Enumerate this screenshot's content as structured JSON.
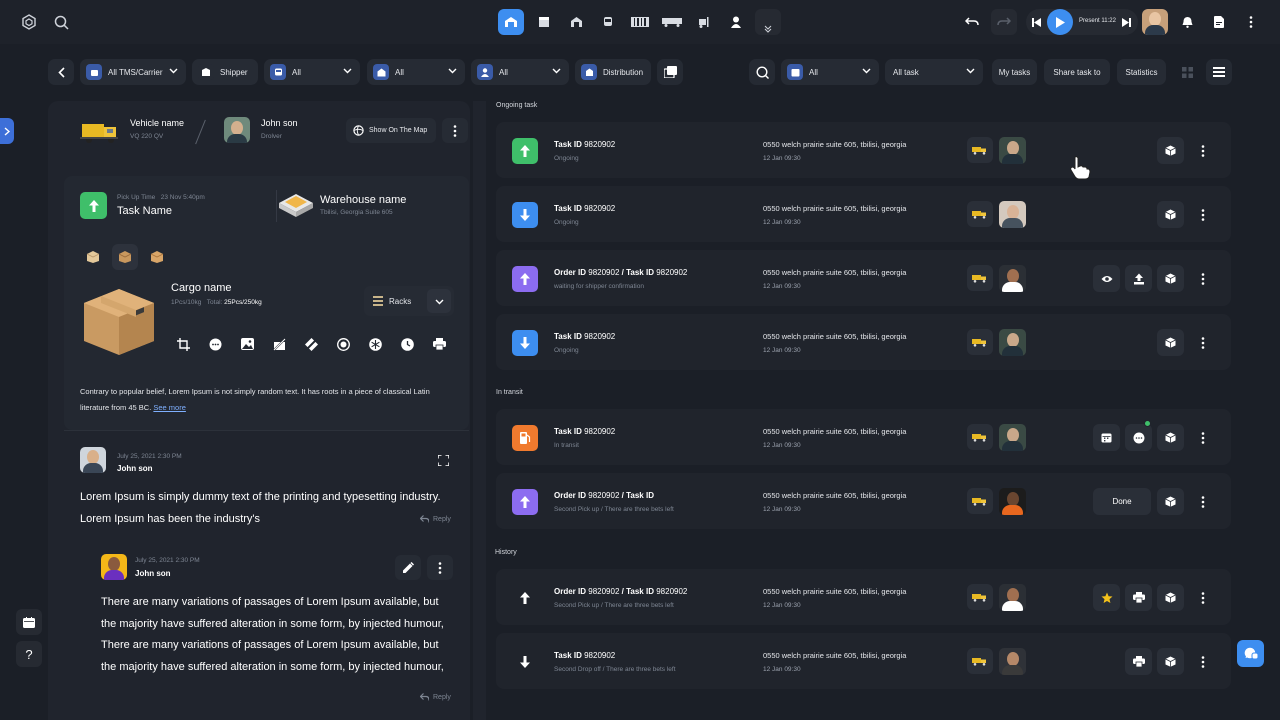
{
  "topbar": {
    "present_label": "Present 11:22"
  },
  "filters": {
    "tms": "All TMS/Carrier",
    "shipper": "Shipper",
    "f3": "All",
    "f4": "All",
    "f5": "All",
    "distribution": "Distribution",
    "status": "All",
    "task_filter": "All task",
    "my_tasks": "My tasks",
    "share_task": "Share task to",
    "statistics": "Statistics"
  },
  "vehicle": {
    "name": "Vehicle name",
    "code": "VQ 220 QV",
    "driver_name": "John son",
    "driver_role": "Drolver",
    "map_button": "Show On The Map"
  },
  "task_card": {
    "pickup_label": "Pick Up Time",
    "pickup_time": "23 Nov 5:40pm",
    "task_name": "Task Name",
    "warehouse_name": "Warehouse name",
    "warehouse_addr": "Tbilisi, Georgia Suite 605",
    "cargo_name": "Cargo name",
    "cargo_pcs": "1Pcs/10kg",
    "cargo_total_label": "Total:",
    "cargo_total": "25Pcs/250kg",
    "racks_label": "Racks",
    "description": "Contrary to popular belief, Lorem Ipsum is not simply random text. It has roots in a piece of classical Latin literature from 45 BC.",
    "see_more": "See more"
  },
  "comments": [
    {
      "date": "July 25, 2021 2:30 PM",
      "author": "John son",
      "text": "Lorem Ipsum is simply dummy text of the printing and typesetting industry. Lorem Ipsum has been the industry's",
      "reply": "Reply"
    },
    {
      "date": "July 25, 2021 2:30 PM",
      "author": "John son",
      "text": "There are many variations of passages of Lorem Ipsum available, but the majority have suffered alteration in some form, by injected humour, There are many variations of passages of Lorem Ipsum available, but the majority have suffered alteration in some form, by injected humour,",
      "reply": "Reply"
    }
  ],
  "sections": {
    "ongoing": "Ongoing task",
    "transit": "In transit",
    "history": "History"
  },
  "tasks": [
    {
      "kind": "Task ID",
      "id": "9820902",
      "kind2": "",
      "id2": "",
      "sub": "Ongoing",
      "addr": "0550 welch prairie suite 605, tbilisi, georgia",
      "date": "12 Jan  09:30",
      "color": "#3fbf6a",
      "arrow": "up"
    },
    {
      "kind": "Task ID",
      "id": "9820902",
      "kind2": "",
      "id2": "",
      "sub": "Ongoing",
      "addr": "0550 welch prairie suite 605, tbilisi, georgia",
      "date": "12 Jan  09:30",
      "color": "#3d8ef0",
      "arrow": "down"
    },
    {
      "kind": "Order ID",
      "id": "9820902",
      "kind2": "Task ID",
      "id2": "9820902",
      "sub": "waiting for shipper confirmation",
      "addr": "0550 welch prairie suite 605, tbilisi, georgia",
      "date": "12 Jan  09:30",
      "color": "#8c6cf0",
      "arrow": "up"
    },
    {
      "kind": "Task ID",
      "id": "9820902",
      "kind2": "",
      "id2": "",
      "sub": "Ongoing",
      "addr": "0550 welch prairie suite 605, tbilisi, georgia",
      "date": "12 Jan  09:30",
      "color": "#3d8ef0",
      "arrow": "down"
    },
    {
      "kind": "Task ID",
      "id": "9820902",
      "kind2": "",
      "id2": "",
      "sub": "In transit",
      "addr": "0550 welch prairie suite 605, tbilisi, georgia",
      "date": "12 Jan  09:30",
      "color": "#f07a2e",
      "arrow": "fuel"
    },
    {
      "kind": "Order ID",
      "id": "9820902",
      "kind2": "Task ID",
      "id2": "",
      "sub": "Second Pick up / There are three bets left",
      "addr": "0550 welch prairie suite 605, tbilisi, georgia",
      "date": "12 Jan  09:30",
      "color": "#8c6cf0",
      "arrow": "up"
    },
    {
      "kind": "Order ID",
      "id": "9820902",
      "kind2": "Task ID",
      "id2": "9820902",
      "sub": "Second Pick up / There are three bets left",
      "addr": "0550 welch prairie suite 605, tbilisi, georgia",
      "date": "12 Jan  09:30",
      "color": "none",
      "arrow": "up"
    },
    {
      "kind": "Task ID",
      "id": "9820902",
      "kind2": "",
      "id2": "",
      "sub": "Second Drop off / There are three bets left",
      "addr": "0550 welch prairie suite 605, tbilisi, georgia",
      "date": "12 Jan  09:30",
      "color": "none",
      "arrow": "down"
    }
  ],
  "done_label": "Done",
  "colors": {
    "accent": "#3d8ef0",
    "bg": "#1b1f27",
    "panel": "#20242d"
  }
}
